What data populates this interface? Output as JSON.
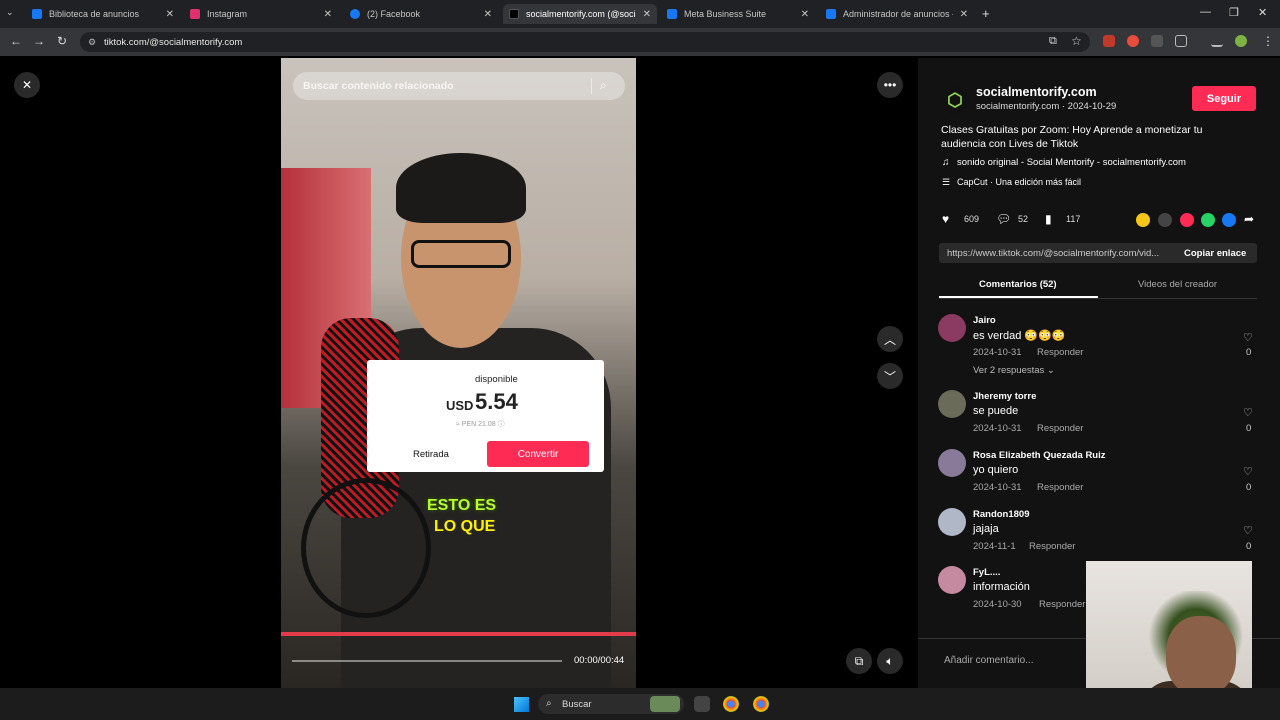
{
  "browser": {
    "tabs": [
      {
        "label": "Biblioteca de anuncios",
        "favicon_color": "#1877f2",
        "active": false
      },
      {
        "label": "Instagram",
        "favicon_color": "#e1306c",
        "active": false
      },
      {
        "label": "(2) Facebook",
        "favicon_color": "#1877f2",
        "active": false
      },
      {
        "label": "socialmentorify.com (@socialm",
        "favicon_color": "#000000",
        "active": true
      },
      {
        "label": "Meta Business Suite",
        "favicon_color": "#1877f2",
        "active": false
      },
      {
        "label": "Administrador de anuncios - A",
        "favicon_color": "#1877f2",
        "active": false
      }
    ],
    "new_tab": "+",
    "url": "tiktok.com/@socialmentorify.com"
  },
  "video": {
    "search_placeholder": "Buscar contenido relacionado",
    "popup": {
      "title": "disponible",
      "currency": "USD",
      "amount": "5.54",
      "pen": "≈ PEN 21.08 ⓘ",
      "withdraw": "Retirada",
      "convert": "Convertir"
    },
    "caption_line1": "ESTO ES",
    "caption_line2": "LO QUE",
    "time": "00:00/00:44",
    "progress": 0
  },
  "post": {
    "author": "socialmentorify.com",
    "handle_date": "socialmentorify.com · 2024-10-29",
    "follow": "Seguir",
    "description": "Clases Gratuitas por Zoom: Hoy Aprende a monetizar tu audiencia con Lives de Tiktok",
    "sound": "sonido original - Social Mentorify - socialmentorify.com",
    "capcut": "CapCut · Una edición más fácil",
    "likes": "609",
    "comments": "52",
    "saves": "117",
    "link": "https://www.tiktok.com/@socialmentorify.com/vid...",
    "copy_link": "Copiar enlace",
    "tab_comments": "Comentarios (52)",
    "tab_videos": "Videos del creador"
  },
  "comments": [
    {
      "name": "Jairo",
      "text": "es verdad 😳😳😳",
      "date": "2024-10-31",
      "reply": "Responder",
      "likes": "0",
      "avatar_color": "#8b3a62"
    },
    {
      "name": "Jheremy torre",
      "text": "se puede",
      "date": "2024-10-31",
      "reply": "Responder",
      "likes": "0",
      "avatar_color": "#6b6b5a"
    },
    {
      "name": "Rosa Elizabeth Quezada Ruiz",
      "text": "yo quiero",
      "date": "2024-10-31",
      "reply": "Responder",
      "likes": "0",
      "avatar_color": "#8a7a9a"
    },
    {
      "name": "Randon1809",
      "text": "jajaja",
      "date": "2024-11-1",
      "reply": "Responder",
      "likes": "0",
      "avatar_color": "#b0b8c8"
    },
    {
      "name": "FyL....",
      "text": "información",
      "date": "2024-10-30",
      "reply": "Responder",
      "likes": "",
      "avatar_color": "#c58aa0"
    }
  ],
  "more_replies": "Ver 2 respuestas ⌄",
  "add_comment": "Añadir comentario...",
  "taskbar": {
    "search": "Buscar"
  }
}
